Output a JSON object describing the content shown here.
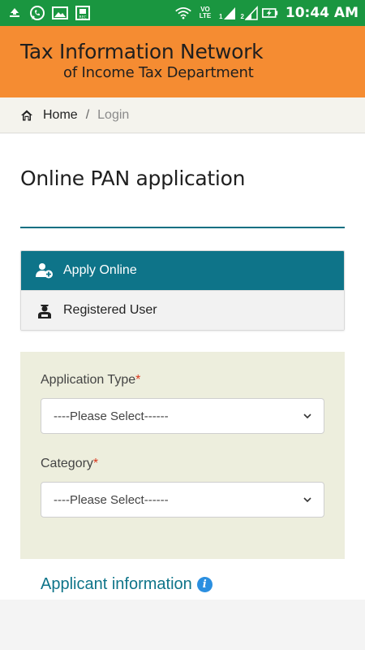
{
  "status_bar": {
    "time": "10:44 AM",
    "network_label": "VO LTE",
    "sim1": "1",
    "sim2": "2",
    "icons": [
      "upload-icon",
      "whatsapp-icon",
      "gallery-icon",
      "screen-record-icon",
      "wifi-icon",
      "signal-icon",
      "battery-charging-icon"
    ]
  },
  "header": {
    "line1": "Tax Information Network",
    "line2": "of Income Tax Department"
  },
  "breadcrumb": {
    "home": "Home",
    "separator": "/",
    "current": "Login"
  },
  "page": {
    "title": "Online PAN application"
  },
  "tabs": [
    {
      "label": "Apply Online",
      "active": true,
      "icon": "add-user-icon"
    },
    {
      "label": "Registered User",
      "active": false,
      "icon": "registered-user-icon"
    }
  ],
  "form": {
    "application_type": {
      "label": "Application Type",
      "required_mark": "*",
      "value": "----Please Select------"
    },
    "category": {
      "label": "Category",
      "required_mark": "*",
      "value": "----Please Select------"
    }
  },
  "section": {
    "applicant_information": "Applicant information",
    "info_glyph": "i"
  },
  "colors": {
    "status_bar": "#1a9640",
    "header": "#f58c32",
    "accent": "#0e7489",
    "form_panel": "#edeedd",
    "required": "#d9381e"
  }
}
